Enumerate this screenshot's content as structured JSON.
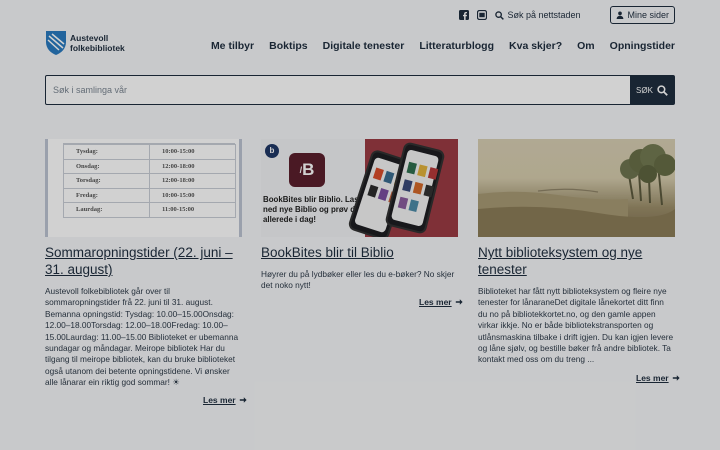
{
  "header": {
    "logo_line1": "Austevoll",
    "logo_line2": "folkebibliotek",
    "search_link": "Søk på nettstaden",
    "mine_sider": "Mine sider",
    "icons": [
      "facebook-icon",
      "instagram-icon",
      "search-icon",
      "user-icon"
    ]
  },
  "nav": {
    "items": [
      "Me tilbyr",
      "Boktips",
      "Digitale tenester",
      "Litteraturblogg",
      "Kva skjer?",
      "Om",
      "Opningstider"
    ]
  },
  "search": {
    "placeholder": "Søk i samlinga vår",
    "button": "SØK"
  },
  "schedule_image": {
    "rows": [
      [
        "Tysdag:",
        "10:00-15:00"
      ],
      [
        "Onsdag:",
        "12:00-18:00"
      ],
      [
        "Torsdag:",
        "12:00-18:00"
      ],
      [
        "Fredag:",
        "10:00-15:00"
      ],
      [
        "Laurdag:",
        "11:00-15:00"
      ]
    ]
  },
  "bookbites_image": {
    "badge": "b",
    "logo": "B",
    "text": "BookBites blir Biblio. Last ned nye Biblio og prøv den allerede i dag!"
  },
  "cards": [
    {
      "title": "Sommaropningstider (22. juni – 31. august)",
      "text": "Austevoll folkebibliotek går over til sommaropningstider frå 22. juni til 31. august. Bemanna opningstid: Tysdag: 10.00–15.00Onsdag: 12.00–18.00Torsdag: 12.00–18.00Fredag: 10.00–15.00Laurdag: 11.00–15.00 Biblioteket er ubemanna sundagar og måndagar. Meirope bibliotek Har du tilgang til meirope bibliotek, kan du bruke biblioteket også utanom dei betente opningstidene. Vi ønsker alle lånarar ein riktig god sommar! ☀",
      "more": "Les mer"
    },
    {
      "title": "BookBites blir til Biblio",
      "text": "Høyrer du på lydbøker eller les du e-bøker? No skjer det noko nytt!",
      "more": "Les mer"
    },
    {
      "title": "Nytt biblioteksystem og nye tenester",
      "text": "Biblioteket har fått nytt biblioteksystem og fleire nye tenester for lånaraneDet digitale lånekortet ditt finn du no på bibliotekkortet.no, og den gamle appen virkar ikkje. No er både bibliotekstransporten og utlånsmaskina tilbake i drift igjen. Du kan igjen levere og låne sjølv, og bestille bøker frå andre bibliotek. Ta kontakt med oss om du treng ...",
      "more": "Les mer"
    }
  ],
  "colors": {
    "primary": "#1f2e3f",
    "background": "#f5f6f8",
    "logo_blue": "#2a7bc0",
    "bookbites_red": "#9b3b44"
  }
}
